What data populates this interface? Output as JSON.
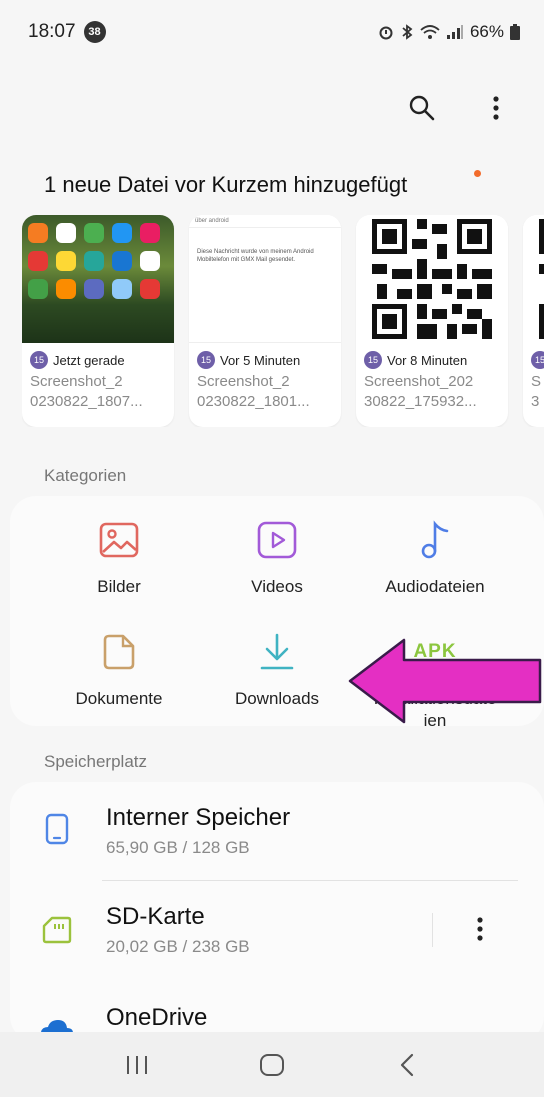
{
  "status_bar": {
    "time": "18:07",
    "notification_count": "38",
    "battery": "66%"
  },
  "recent": {
    "title": "1 neue Datei vor Kurzem hinzugefügt",
    "items": [
      {
        "time": "Jetzt gerade",
        "name_line1": "Screenshot_2",
        "name_line2": "0230822_1807..."
      },
      {
        "time": "Vor 5 Minuten",
        "name_line1": "Screenshot_2",
        "name_line2": "0230822_1801...",
        "thumb_header": "über android",
        "thumb_text": "Diese Nachricht wurde von meinem Android Mobiltelefon mit GMX Mail gesendet."
      },
      {
        "time": "Vor 8 Minuten",
        "name_line1": "Screenshot_202",
        "name_line2": "30822_175932..."
      },
      {
        "name_line1": "S",
        "name_line2": "3"
      }
    ],
    "badge": "15"
  },
  "categories": {
    "label": "Kategorien",
    "items": [
      {
        "label": "Bilder",
        "icon": "image-icon",
        "color": "#e0675f"
      },
      {
        "label": "Videos",
        "icon": "video-icon",
        "color": "#a25ad8"
      },
      {
        "label": "Audiodateien",
        "icon": "music-icon",
        "color": "#4f7de6"
      },
      {
        "label": "Dokumente",
        "icon": "document-icon",
        "color": "#c9a06a"
      },
      {
        "label": "Downloads",
        "icon": "download-icon",
        "color": "#3fb3c2"
      },
      {
        "label": "Installationsdateien",
        "label_line1": "Installationsdate",
        "label_line2": "ien",
        "icon_text": "APK",
        "color": "#8cc63f"
      }
    ]
  },
  "storage": {
    "label": "Speicherplatz",
    "items": [
      {
        "name": "Interner Speicher",
        "size": "65,90 GB / 128 GB",
        "icon": "phone-icon",
        "color": "#4f86e6"
      },
      {
        "name": "SD-Karte",
        "size": "20,02 GB / 238 GB",
        "icon": "sd-card-icon",
        "color": "#9bc23c"
      },
      {
        "name": "OneDrive",
        "icon": "cloud-icon",
        "color": "#1c6fd1"
      }
    ]
  },
  "annotation": {
    "color": "#e42fc3"
  }
}
